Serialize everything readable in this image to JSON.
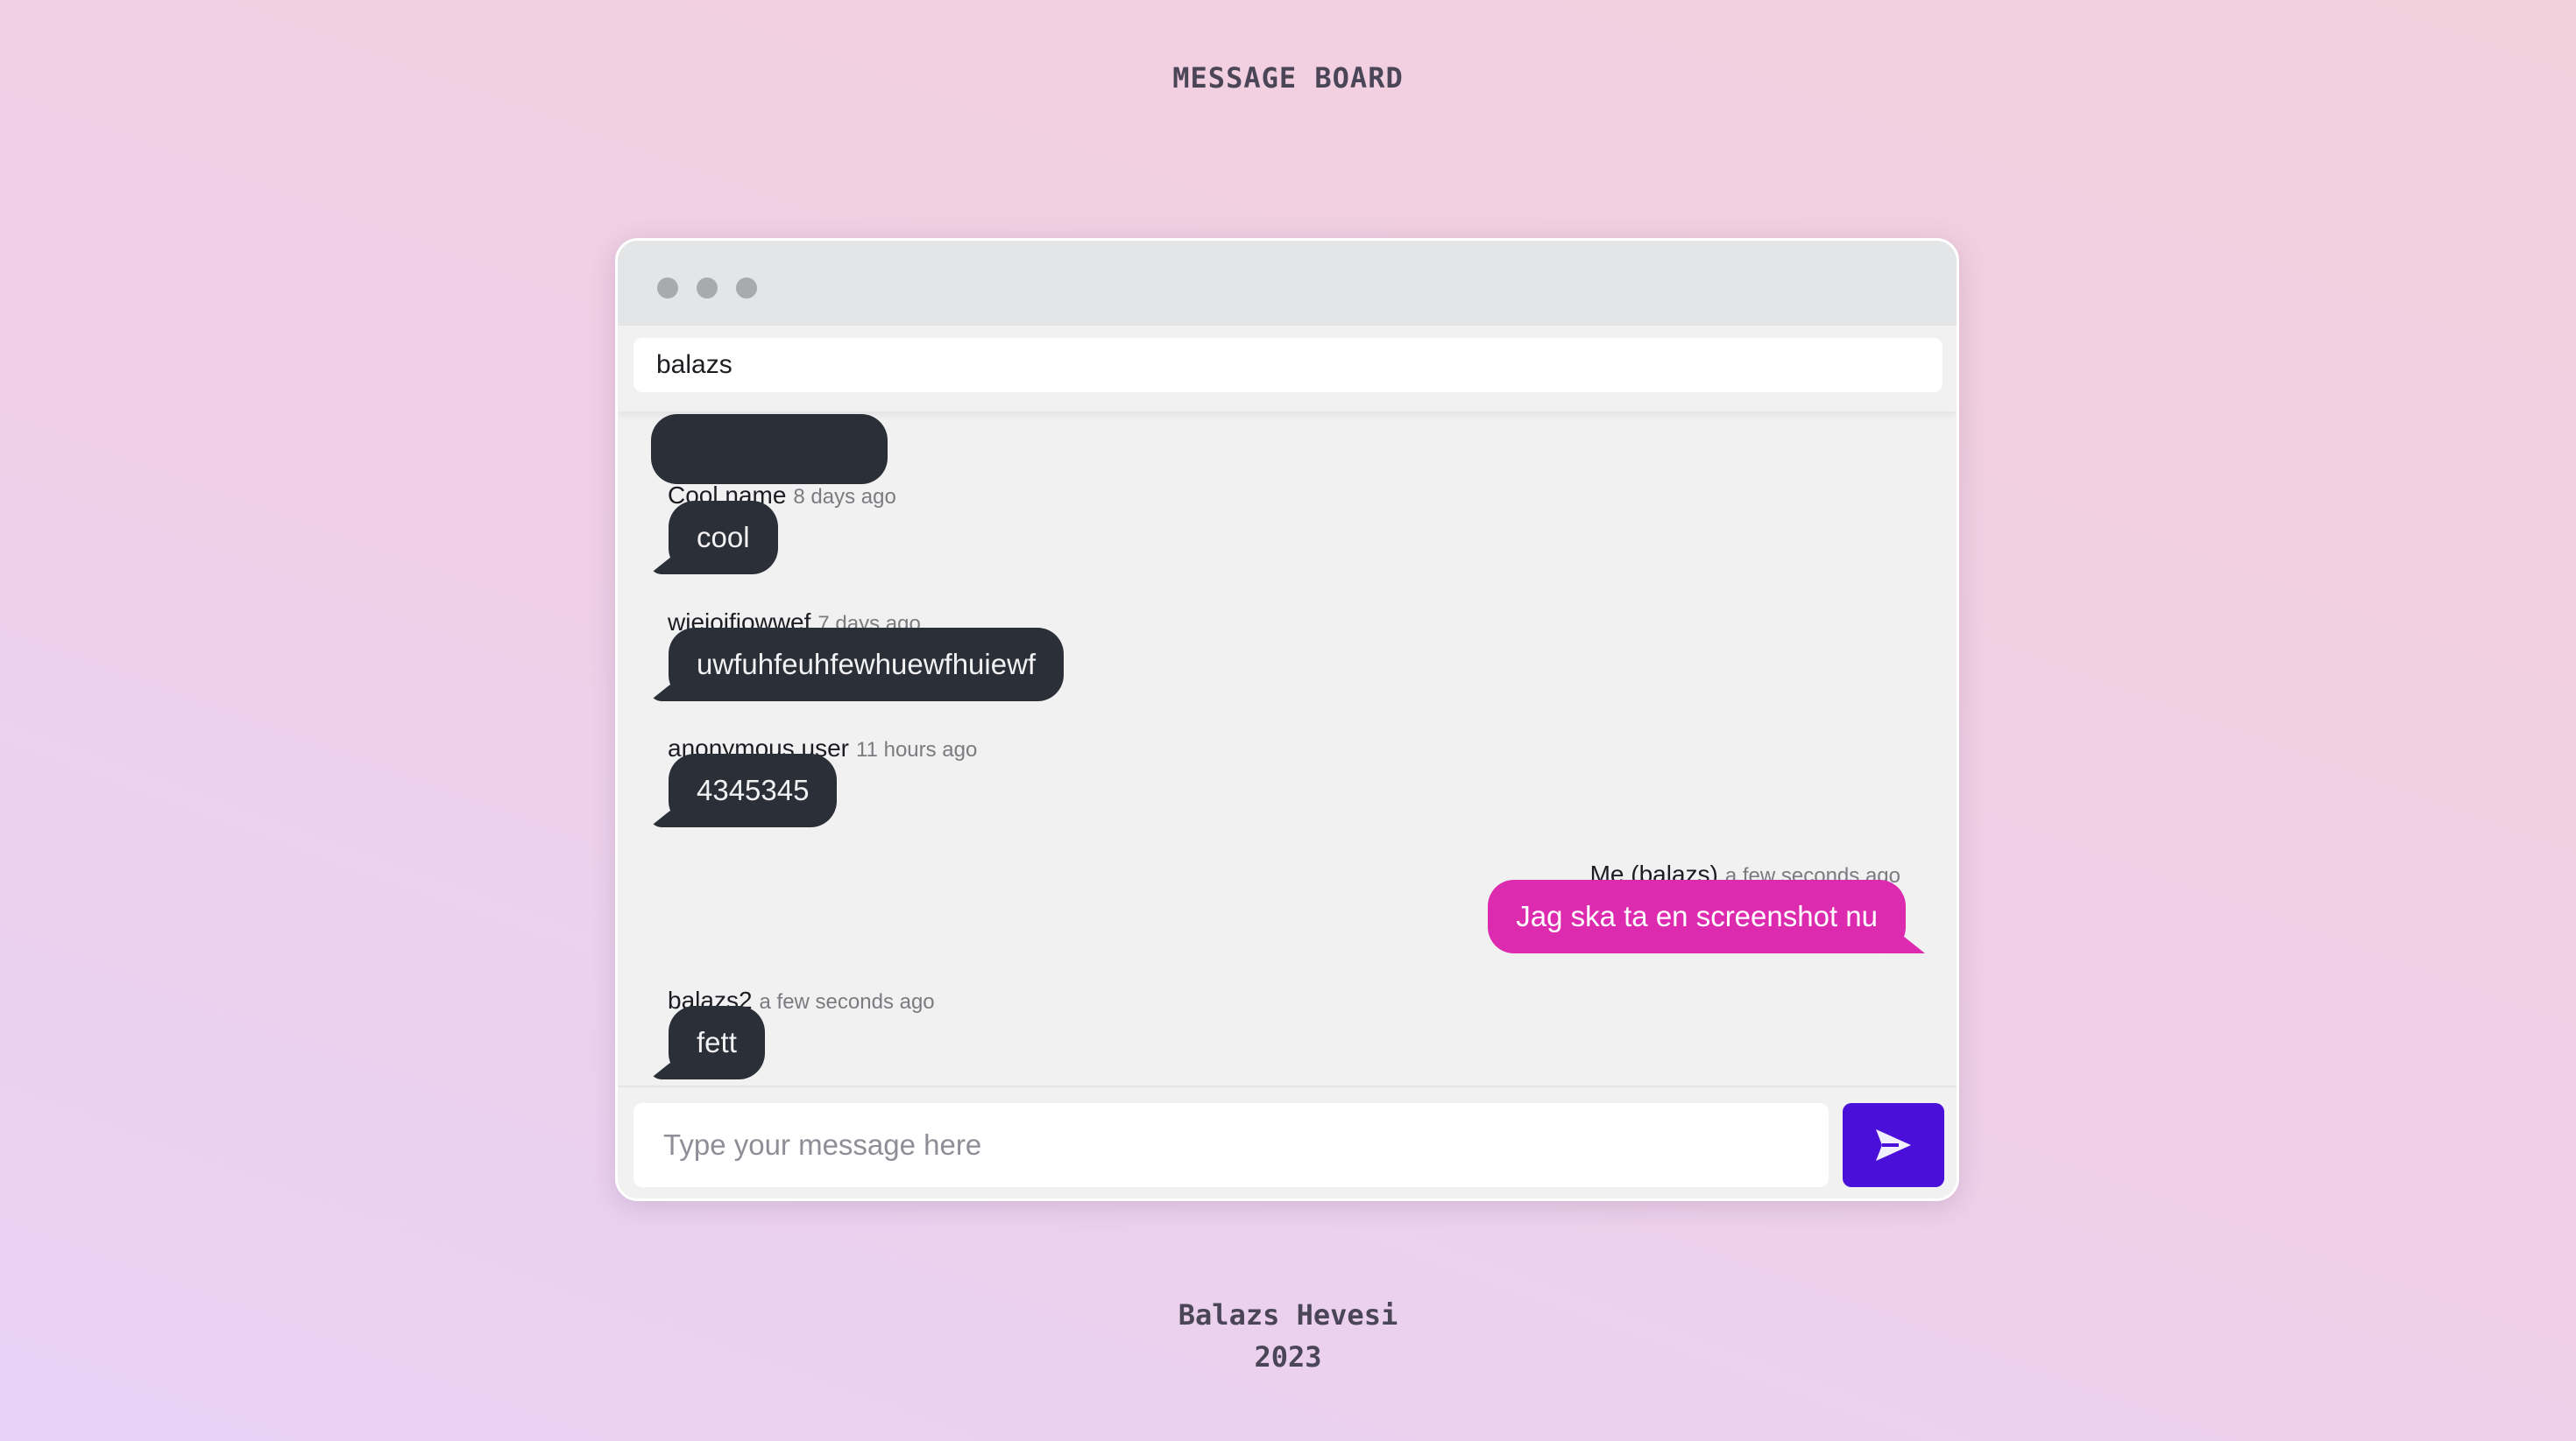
{
  "page": {
    "title": "MESSAGE BOARD"
  },
  "window": {
    "name_input_value": "balazs"
  },
  "messages": [
    {
      "author": "Cool name",
      "time": "8 days ago",
      "text": "cool",
      "mine": false
    },
    {
      "author": "wjeiojfiowwef",
      "time": "7 days ago",
      "text": "uwfuhfeuhfewhuewfhuiewf",
      "mine": false
    },
    {
      "author": "anonymous user",
      "time": "11 hours ago",
      "text": "4345345",
      "mine": false
    },
    {
      "author": "Me (balazs)",
      "time": "a few seconds ago",
      "text": "Jag ska ta en screenshot nu",
      "mine": true
    },
    {
      "author": "balazs2",
      "time": "a few seconds ago",
      "text": "fett",
      "mine": false
    }
  ],
  "composer": {
    "placeholder": "Type your message here",
    "send_icon": "send-icon"
  },
  "footer": {
    "author": "Balazs Hevesi",
    "year": "2023"
  },
  "colors": {
    "other_bubble": "#2b2f38",
    "my_bubble": "#dd2bb0",
    "send_button": "#4a10d9"
  }
}
